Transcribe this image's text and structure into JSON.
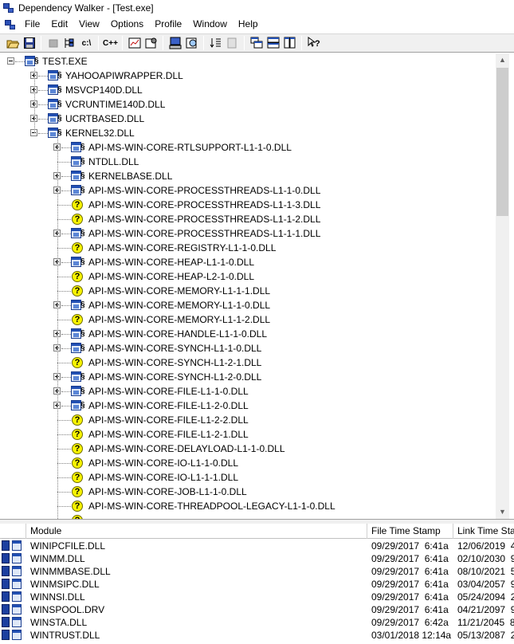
{
  "window": {
    "title": "Dependency Walker - [Test.exe]"
  },
  "menu": [
    "File",
    "Edit",
    "View",
    "Options",
    "Profile",
    "Window",
    "Help"
  ],
  "toolbar": {
    "copy_text": "c:\\",
    "cplusplus_text": "C++"
  },
  "tree": [
    {
      "label": "TEST.EXE",
      "level": 0,
      "icon": "module",
      "expander": "minus"
    },
    {
      "label": "YAHOOAPIWRAPPER.DLL",
      "level": 1,
      "icon": "module",
      "expander": "plus"
    },
    {
      "label": "MSVCP140D.DLL",
      "level": 1,
      "icon": "module",
      "expander": "plus"
    },
    {
      "label": "VCRUNTIME140D.DLL",
      "level": 1,
      "icon": "module",
      "expander": "plus"
    },
    {
      "label": "UCRTBASED.DLL",
      "level": 1,
      "icon": "module",
      "expander": "plus"
    },
    {
      "label": "KERNEL32.DLL",
      "level": 1,
      "icon": "module",
      "expander": "minus"
    },
    {
      "label": "API-MS-WIN-CORE-RTLSUPPORT-L1-1-0.DLL",
      "level": 2,
      "icon": "module",
      "expander": "plus"
    },
    {
      "label": "NTDLL.DLL",
      "level": 2,
      "icon": "module",
      "expander": "none"
    },
    {
      "label": "KERNELBASE.DLL",
      "level": 2,
      "icon": "module",
      "expander": "plus"
    },
    {
      "label": "API-MS-WIN-CORE-PROCESSTHREADS-L1-1-0.DLL",
      "level": 2,
      "icon": "module",
      "expander": "plus"
    },
    {
      "label": "API-MS-WIN-CORE-PROCESSTHREADS-L1-1-3.DLL",
      "level": 2,
      "icon": "missing",
      "expander": "none"
    },
    {
      "label": "API-MS-WIN-CORE-PROCESSTHREADS-L1-1-2.DLL",
      "level": 2,
      "icon": "missing",
      "expander": "none"
    },
    {
      "label": "API-MS-WIN-CORE-PROCESSTHREADS-L1-1-1.DLL",
      "level": 2,
      "icon": "module",
      "expander": "plus"
    },
    {
      "label": "API-MS-WIN-CORE-REGISTRY-L1-1-0.DLL",
      "level": 2,
      "icon": "missing",
      "expander": "none"
    },
    {
      "label": "API-MS-WIN-CORE-HEAP-L1-1-0.DLL",
      "level": 2,
      "icon": "module",
      "expander": "plus"
    },
    {
      "label": "API-MS-WIN-CORE-HEAP-L2-1-0.DLL",
      "level": 2,
      "icon": "missing",
      "expander": "none"
    },
    {
      "label": "API-MS-WIN-CORE-MEMORY-L1-1-1.DLL",
      "level": 2,
      "icon": "missing",
      "expander": "none"
    },
    {
      "label": "API-MS-WIN-CORE-MEMORY-L1-1-0.DLL",
      "level": 2,
      "icon": "module",
      "expander": "plus"
    },
    {
      "label": "API-MS-WIN-CORE-MEMORY-L1-1-2.DLL",
      "level": 2,
      "icon": "missing",
      "expander": "none"
    },
    {
      "label": "API-MS-WIN-CORE-HANDLE-L1-1-0.DLL",
      "level": 2,
      "icon": "module",
      "expander": "plus"
    },
    {
      "label": "API-MS-WIN-CORE-SYNCH-L1-1-0.DLL",
      "level": 2,
      "icon": "module",
      "expander": "plus"
    },
    {
      "label": "API-MS-WIN-CORE-SYNCH-L1-2-1.DLL",
      "level": 2,
      "icon": "missing",
      "expander": "none"
    },
    {
      "label": "API-MS-WIN-CORE-SYNCH-L1-2-0.DLL",
      "level": 2,
      "icon": "module",
      "expander": "plus"
    },
    {
      "label": "API-MS-WIN-CORE-FILE-L1-1-0.DLL",
      "level": 2,
      "icon": "module",
      "expander": "plus"
    },
    {
      "label": "API-MS-WIN-CORE-FILE-L1-2-0.DLL",
      "level": 2,
      "icon": "module",
      "expander": "plus"
    },
    {
      "label": "API-MS-WIN-CORE-FILE-L1-2-2.DLL",
      "level": 2,
      "icon": "missing",
      "expander": "none"
    },
    {
      "label": "API-MS-WIN-CORE-FILE-L1-2-1.DLL",
      "level": 2,
      "icon": "missing",
      "expander": "none"
    },
    {
      "label": "API-MS-WIN-CORE-DELAYLOAD-L1-1-0.DLL",
      "level": 2,
      "icon": "missing",
      "expander": "none"
    },
    {
      "label": "API-MS-WIN-CORE-IO-L1-1-0.DLL",
      "level": 2,
      "icon": "missing",
      "expander": "none"
    },
    {
      "label": "API-MS-WIN-CORE-IO-L1-1-1.DLL",
      "level": 2,
      "icon": "missing",
      "expander": "none"
    },
    {
      "label": "API-MS-WIN-CORE-JOB-L1-1-0.DLL",
      "level": 2,
      "icon": "missing",
      "expander": "none"
    },
    {
      "label": "API-MS-WIN-CORE-THREADPOOL-LEGACY-L1-1-0.DLL",
      "level": 2,
      "icon": "missing",
      "expander": "none"
    }
  ],
  "list": {
    "columns": [
      "Module",
      "File Time Stamp",
      "Link Time Sta"
    ],
    "rows": [
      {
        "module": "WINIPCFILE.DLL",
        "file_ts": "09/29/2017  6:41a",
        "link_ts": "12/06/2019  4"
      },
      {
        "module": "WINMM.DLL",
        "file_ts": "09/29/2017  6:41a",
        "link_ts": "02/10/2030  9"
      },
      {
        "module": "WINMMBASE.DLL",
        "file_ts": "09/29/2017  6:41a",
        "link_ts": "08/10/2021  5"
      },
      {
        "module": "WINMSIPC.DLL",
        "file_ts": "09/29/2017  6:41a",
        "link_ts": "03/04/2057  9"
      },
      {
        "module": "WINNSI.DLL",
        "file_ts": "09/29/2017  6:41a",
        "link_ts": "05/24/2094  2"
      },
      {
        "module": "WINSPOOL.DRV",
        "file_ts": "09/29/2017  6:41a",
        "link_ts": "04/21/2097  9"
      },
      {
        "module": "WINSTA.DLL",
        "file_ts": "09/29/2017  6:42a",
        "link_ts": "11/21/2045  8"
      },
      {
        "module": "WINTRUST.DLL",
        "file_ts": "03/01/2018 12:14a",
        "link_ts": "05/13/2087  2"
      }
    ]
  }
}
